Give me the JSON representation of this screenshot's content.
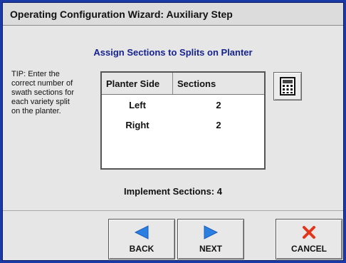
{
  "window": {
    "title": "Operating Configuration Wizard:  Auxiliary Step"
  },
  "heading": "Assign Sections to Splits on Planter",
  "tip": "TIP:  Enter the\ncorrect number of\nswath sections for\neach variety split\non the planter.",
  "table": {
    "headers": [
      "Planter Side",
      "Sections"
    ],
    "rows": [
      {
        "side": "Left",
        "sections": "2"
      },
      {
        "side": "Right",
        "sections": "2"
      }
    ]
  },
  "implement": {
    "label": "Implement Sections: 4"
  },
  "buttons": {
    "back": "BACK",
    "next": "NEXT",
    "cancel": "CANCEL"
  },
  "icons": {
    "calculator": "calculator-icon",
    "back": "left-arrow-icon",
    "next": "right-arrow-icon",
    "cancel": "x-icon"
  },
  "colors": {
    "frame": "#1a3aa6",
    "heading": "#16238f",
    "arrow": "#2a7fe0",
    "cancel": "#e2361b"
  }
}
